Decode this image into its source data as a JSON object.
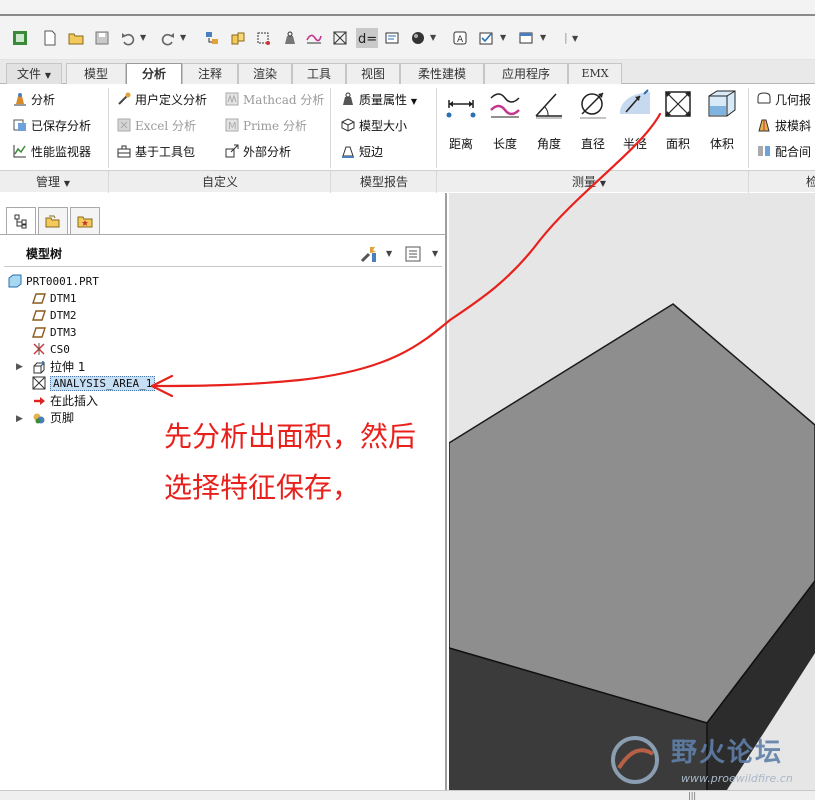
{
  "ribbon_tabs": [
    "文件",
    "模型",
    "分析",
    "注释",
    "渲染",
    "工具",
    "视图",
    "柔性建模",
    "应用程序",
    "EMX"
  ],
  "ribbon": {
    "manage": {
      "analysis": "分析",
      "saved_analysis": "已保存分析",
      "performance_monitor": "性能监视器",
      "group_label": "管理"
    },
    "custom": {
      "user_defined": "用户定义分析",
      "excel": "Excel 分析",
      "toolkit": "基于工具包",
      "mathcad": "Mathcad 分析",
      "prime": "Prime 分析",
      "external": "外部分析",
      "group_label": "自定义"
    },
    "model_report": {
      "mass_props": "质量属性",
      "model_size": "模型大小",
      "short_edge": "短边",
      "group_label": "模型报告"
    },
    "measure": {
      "distance": "距离",
      "length": "长度",
      "angle": "角度",
      "diameter": "直径",
      "radius": "半径",
      "area": "面积",
      "volume": "体积",
      "group_label": "测量"
    },
    "inspect": {
      "geometry": "几何报",
      "draft": "拔模斜",
      "mating": "配合间",
      "group_label": "检"
    }
  },
  "tree": {
    "title": "模型树",
    "nodes": {
      "root": "PRT0001.PRT",
      "dtm1": "DTM1",
      "dtm2": "DTM2",
      "dtm3": "DTM3",
      "csys": "CS0",
      "extrude": "拉伸 1",
      "analysis": "ANALYSIS_AREA_1",
      "insert_here": "在此插入",
      "footer": "页脚"
    }
  },
  "annotation": {
    "line1": "先分析出面积，然后",
    "line2": "选择特征保存，"
  },
  "watermark": {
    "text": "野火论坛",
    "url": "www.proewildfire.cn"
  },
  "colors": {
    "annotation_red": "#e8211d",
    "selection_blue": "#c7dff5",
    "part_gray": "#8e8e8e"
  }
}
